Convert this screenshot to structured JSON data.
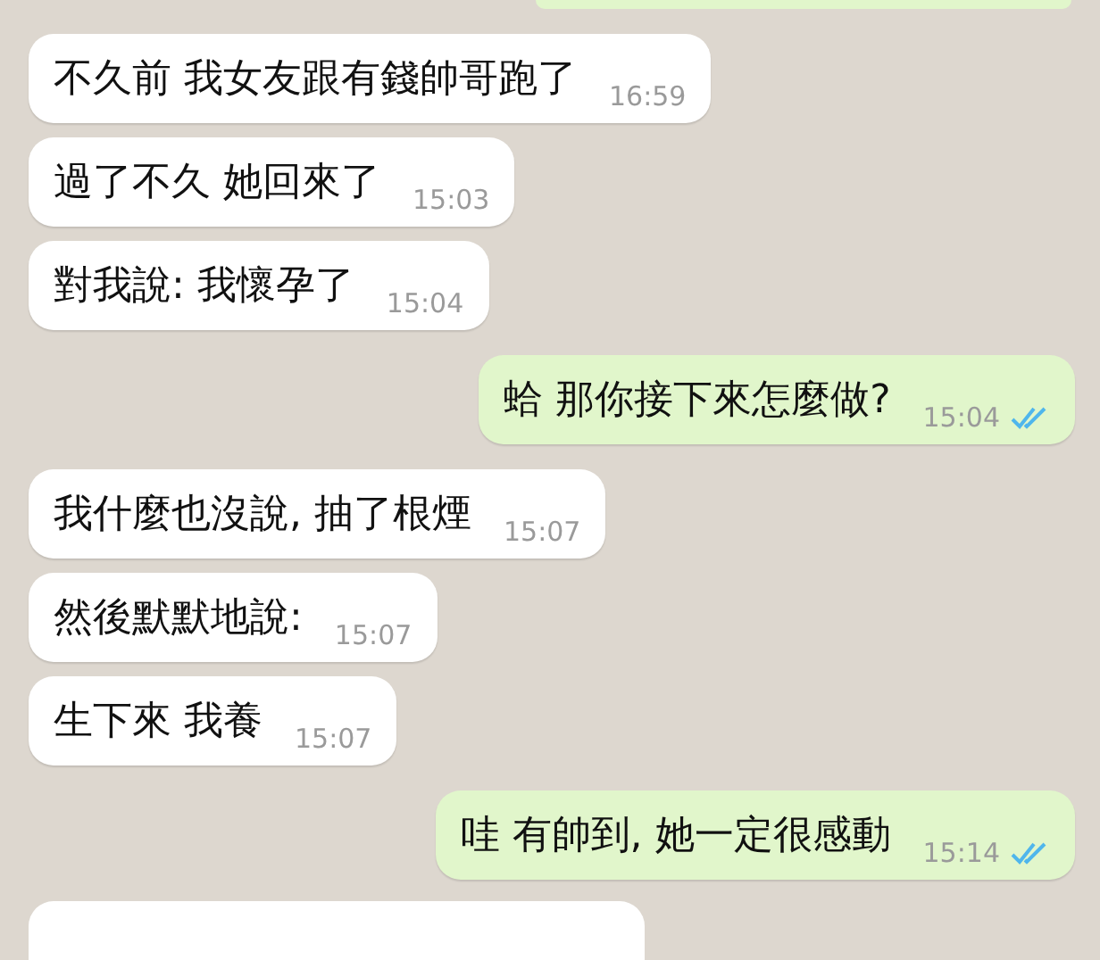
{
  "messages": [
    {
      "outgoing": true,
      "kind": "cut-top"
    },
    {
      "outgoing": false,
      "kind": "full",
      "text": "不久前 我女友跟有錢帥哥跑了",
      "time": "16:59"
    },
    {
      "outgoing": false,
      "kind": "full",
      "text": "過了不久 她回來了",
      "time": "15:03"
    },
    {
      "outgoing": false,
      "kind": "full",
      "text": "對我說: 我懷孕了",
      "time": "15:04"
    },
    {
      "outgoing": true,
      "kind": "full",
      "text": "蛤 那你接下來怎麼做?",
      "time": "15:04",
      "read": true
    },
    {
      "outgoing": false,
      "kind": "full",
      "text": "我什麼也沒說, 抽了根煙",
      "time": "15:07"
    },
    {
      "outgoing": false,
      "kind": "full",
      "text": "然後默默地說:",
      "time": "15:07"
    },
    {
      "outgoing": false,
      "kind": "full",
      "text": "生下來 我養",
      "time": "15:07"
    },
    {
      "outgoing": true,
      "kind": "full",
      "text": "哇 有帥到, 她一定很感動",
      "time": "15:14",
      "read": true
    },
    {
      "outgoing": false,
      "kind": "cut-bottom"
    }
  ]
}
